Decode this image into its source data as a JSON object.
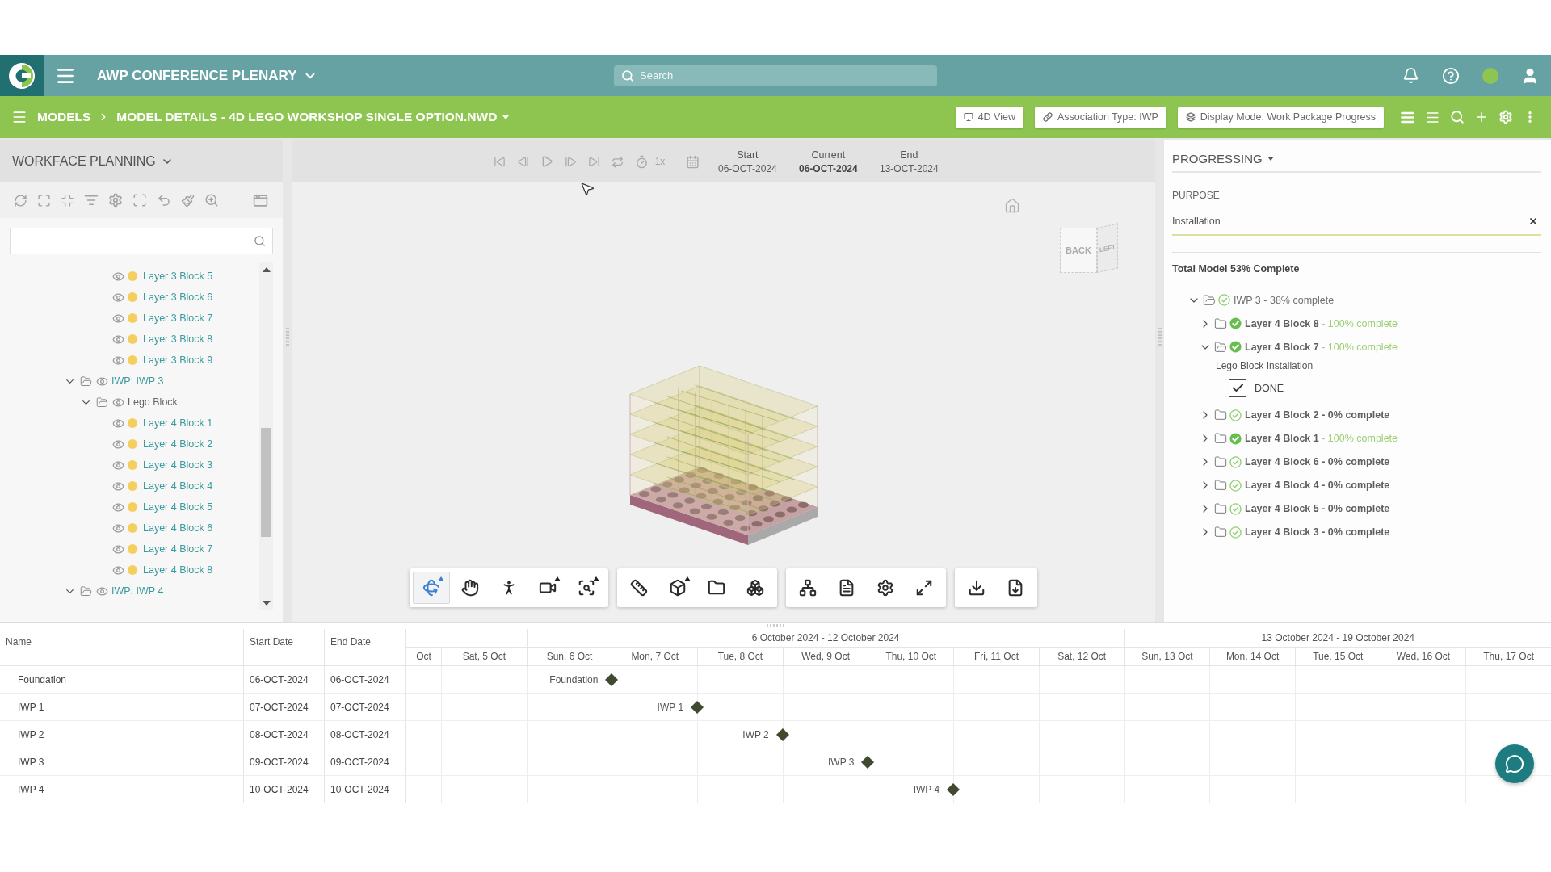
{
  "app_bar": {
    "title": "AWP CONFERENCE PLENARY",
    "search": {
      "placeholder": "Search"
    }
  },
  "breadcrumb": [
    {
      "kind": "link",
      "label": "MODELS"
    },
    {
      "kind": "menu",
      "label": "MODEL DETAILS - 4D LEGO WORKSHOP SINGLE OPTION.NWD"
    }
  ],
  "mode_buttons": [
    {
      "kind": "view",
      "label": "4D View"
    },
    {
      "kind": "association",
      "label": "Association Type: IWP"
    },
    {
      "kind": "display",
      "label": "Display Mode: Work Package Progress"
    }
  ],
  "workface_panel": {
    "title": "WORKFACE PLANNING",
    "tree": [
      {
        "children": [
          {
            "children": [
              {
                "kind": "element",
                "label": "Layer 3 Block 5"
              },
              {
                "kind": "element",
                "label": "Layer 3 Block 6"
              },
              {
                "kind": "element",
                "label": "Layer 3 Block 7"
              },
              {
                "kind": "element",
                "label": "Layer 3 Block 8"
              },
              {
                "kind": "element",
                "label": "Layer 3 Block 9"
              }
            ]
          }
        ]
      },
      {
        "kind": "package",
        "label": "IWP: IWP 3",
        "expanded": true,
        "children": [
          {
            "kind": "group",
            "label": "Lego Block",
            "expanded": true,
            "children": [
              {
                "kind": "element",
                "label": "Layer 4 Block 1"
              },
              {
                "kind": "element",
                "label": "Layer 4 Block 2"
              },
              {
                "kind": "element",
                "label": "Layer 4 Block 3"
              },
              {
                "kind": "element",
                "label": "Layer 4 Block 4"
              },
              {
                "kind": "element",
                "label": "Layer 4 Block 5"
              },
              {
                "kind": "element",
                "label": "Layer 4 Block 6"
              },
              {
                "kind": "element",
                "label": "Layer 4 Block 7"
              },
              {
                "kind": "element",
                "label": "Layer 4 Block 8"
              }
            ]
          }
        ]
      },
      {
        "kind": "package",
        "label": "IWP: IWP 4",
        "expanded": true
      }
    ]
  },
  "playback": {
    "speed": "1x",
    "dates": [
      {
        "kind": "start",
        "label": "Start",
        "value": "06-OCT-2024"
      },
      {
        "kind": "current",
        "label": "Current",
        "value": "06-OCT-2024"
      },
      {
        "kind": "end",
        "label": "End",
        "value": "13-OCT-2024"
      }
    ]
  },
  "view_cube": {
    "faces": [
      "BACK",
      "LEFT"
    ]
  },
  "viewer_toolbar": [
    {
      "tools": [
        {
          "kind": "orbit",
          "selected": true
        },
        {
          "kind": "pan",
          "selected": false
        },
        {
          "kind": "walk",
          "selected": false
        },
        {
          "kind": "camera",
          "selected": false
        },
        {
          "kind": "zoom-window",
          "selected": false
        }
      ]
    },
    {
      "tools": [
        {
          "kind": "measure",
          "selected": false
        },
        {
          "kind": "section",
          "selected": false
        },
        {
          "kind": "folder",
          "selected": false
        },
        {
          "kind": "explode",
          "selected": false
        }
      ]
    },
    {
      "tools": [
        {
          "kind": "tree",
          "selected": false
        },
        {
          "kind": "properties",
          "selected": false
        },
        {
          "kind": "settings",
          "selected": false
        },
        {
          "kind": "fullscreen",
          "selected": false
        }
      ]
    },
    {
      "tools": [
        {
          "kind": "download",
          "selected": false
        },
        {
          "kind": "export",
          "selected": false
        }
      ]
    }
  ],
  "progress_panel": {
    "title": "PROGRESSING",
    "purpose": {
      "label": "PURPOSE",
      "value": "Installation"
    },
    "summary": "Total Model 53% Complete",
    "tree": [
      {
        "kind": "package",
        "label": "IWP 3",
        "status": "- 38% complete",
        "complete": false,
        "expanded": true,
        "children": [
          {
            "kind": "block",
            "label": "Layer 4 Block 8",
            "status": "- 100% complete",
            "complete": true,
            "expanded": false
          },
          {
            "kind": "block",
            "label": "Layer 4 Block 7",
            "status": "- 100% complete",
            "complete": true,
            "expanded": true,
            "activity": {
              "title": "Lego Block Installation",
              "checklist": [
                {
                  "label": "DONE",
                  "checked": true
                }
              ]
            }
          },
          {
            "kind": "block",
            "label": "Layer 4 Block 2",
            "status": "- 0% complete",
            "complete": false,
            "expanded": false
          },
          {
            "kind": "block",
            "label": "Layer 4 Block 1",
            "status": "- 100% complete",
            "complete": true,
            "expanded": false
          },
          {
            "kind": "block",
            "label": "Layer 4 Block 6",
            "status": "- 0% complete",
            "complete": false,
            "expanded": false
          },
          {
            "kind": "block",
            "label": "Layer 4 Block 4",
            "status": "- 0% complete",
            "complete": false,
            "expanded": false
          },
          {
            "kind": "block",
            "label": "Layer 4 Block 5",
            "status": "- 0% complete",
            "complete": false,
            "expanded": false
          },
          {
            "kind": "block",
            "label": "Layer 4 Block 3",
            "status": "- 0% complete",
            "complete": false,
            "expanded": false
          }
        ]
      }
    ]
  },
  "gantt": {
    "columns": [
      "Name",
      "Start Date",
      "End Date"
    ],
    "weeks": [
      {
        "days": [
          "Oct",
          "Sat, 5 Oct"
        ]
      },
      {
        "label": "6 October 2024 - 12 October 2024",
        "days": [
          "Sun, 6 Oct",
          "Mon, 7 Oct",
          "Tue, 8 Oct",
          "Wed, 9 Oct",
          "Thu, 10 Oct",
          "Fri, 11 Oct",
          "Sat, 12 Oct"
        ]
      },
      {
        "label": "13 October 2024 - 19 October 2024",
        "days": [
          "Sun, 13 Oct",
          "Mon, 14 Oct",
          "Tue, 15 Oct",
          "Wed, 16 Oct",
          "Thu, 17 Oct"
        ]
      }
    ],
    "rows": [
      {
        "name": "Foundation",
        "start": "06-OCT-2024",
        "end": "06-OCT-2024",
        "milestone": "Foundation"
      },
      {
        "name": "IWP 1",
        "start": "07-OCT-2024",
        "end": "07-OCT-2024",
        "milestone": "IWP 1"
      },
      {
        "name": "IWP 2",
        "start": "08-OCT-2024",
        "end": "08-OCT-2024",
        "milestone": "IWP 2"
      },
      {
        "name": "IWP 3",
        "start": "09-OCT-2024",
        "end": "09-OCT-2024",
        "milestone": "IWP 3"
      },
      {
        "name": "IWP 4",
        "start": "10-OCT-2024",
        "end": "10-OCT-2024",
        "milestone": "IWP 4"
      }
    ]
  }
}
